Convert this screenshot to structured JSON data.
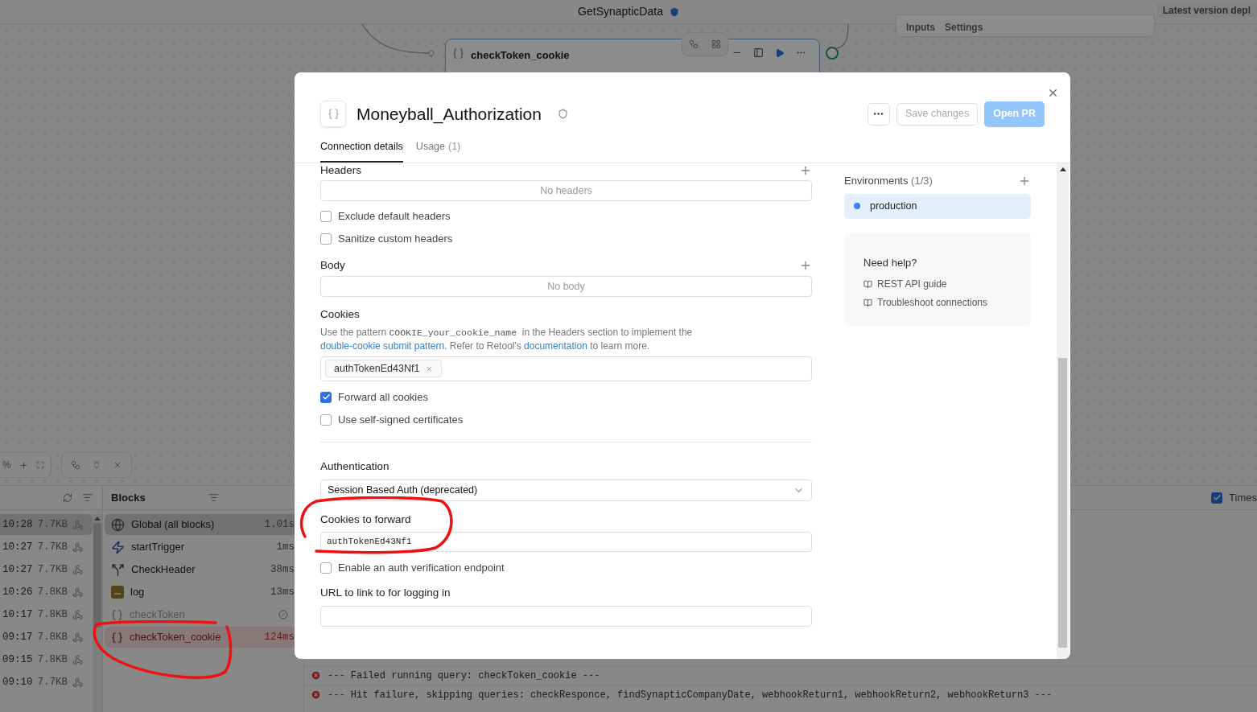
{
  "app": {
    "title": "GetSynapticData",
    "version_label": "Latest version depl"
  },
  "canvas": {
    "node": {
      "title": "checkToken_cookie"
    },
    "side_panel": {
      "tabs": [
        "Inputs",
        "Settings"
      ]
    },
    "zoom_label": "%"
  },
  "runs": {
    "rows": [
      {
        "time": "10:28",
        "size": "7.7KB",
        "selected": true
      },
      {
        "time": "10:27",
        "size": "7.7KB",
        "selected": false
      },
      {
        "time": "10:27",
        "size": "7.7KB",
        "selected": false
      },
      {
        "time": "10:26",
        "size": "7.8KB",
        "selected": false
      },
      {
        "time": "10:17",
        "size": "7.8KB",
        "selected": false
      },
      {
        "time": "09:17",
        "size": "7.8KB",
        "selected": false
      },
      {
        "time": "09:15",
        "size": "7.8KB",
        "selected": false
      },
      {
        "time": "09:10",
        "size": "7.7KB",
        "selected": false
      }
    ]
  },
  "blocks": {
    "title": "Blocks",
    "items": [
      {
        "kind": "global",
        "name": "Global (all blocks)",
        "duration": "1.01s",
        "skipped": false,
        "failed": false,
        "selected": true
      },
      {
        "kind": "trigger",
        "name": "startTrigger",
        "duration": "1ms",
        "skipped": false,
        "failed": false,
        "selected": false
      },
      {
        "kind": "branch",
        "name": "CheckHeader",
        "duration": "38ms",
        "skipped": false,
        "failed": false,
        "selected": false
      },
      {
        "kind": "js",
        "name": "log",
        "duration": "13ms",
        "skipped": false,
        "failed": false,
        "selected": false
      },
      {
        "kind": "resource",
        "name": "checkToken",
        "skipped": true,
        "failed": false,
        "selected": false
      },
      {
        "kind": "resource",
        "name": "checkToken_cookie",
        "duration": "124ms",
        "skipped": false,
        "failed": true,
        "selected": false
      }
    ]
  },
  "log": {
    "timestamps": {
      "label": "Times",
      "checked": true
    },
    "lines": [
      "--- Failed running query: checkToken_cookie ---",
      "--- Hit failure, skipping queries: checkResponce, findSynapticCompanyDate, webhookReturn1, webhookReturn2, webhookReturn3 ---"
    ]
  },
  "modal": {
    "title": "Moneyball_Authorization",
    "buttons": {
      "save": {
        "label": "Save changes",
        "disabled": true
      },
      "open_pr": {
        "label": "Open PR",
        "disabled": true
      }
    },
    "tabs": [
      {
        "label": "Connection details",
        "selected": true
      },
      {
        "label": "Usage",
        "count": "(1)",
        "selected": false
      }
    ],
    "headers": {
      "label": "Headers",
      "empty_text": "No headers"
    },
    "header_options": [
      {
        "label": "Exclude default headers",
        "checked": false
      },
      {
        "label": "Sanitize custom headers",
        "checked": false
      }
    ],
    "body": {
      "label": "Body",
      "empty_text": "No body"
    },
    "cookies": {
      "label": "Cookies",
      "description": [
        {
          "kind": "text",
          "text": "Use the pattern "
        },
        {
          "kind": "code",
          "text": "COOKIE_your_cookie_name"
        },
        {
          "kind": "text",
          "text": "  in the Headers section to implement the "
        },
        {
          "kind": "link",
          "text": "double-cookie submit pattern"
        },
        {
          "kind": "text",
          "text": ". Refer to Retool's "
        },
        {
          "kind": "link",
          "text": "documentation"
        },
        {
          "kind": "text",
          "text": " to learn more."
        }
      ],
      "tags": [
        "authTokenEd43Nf1"
      ],
      "options": [
        {
          "label": "Forward all cookies",
          "checked": true
        },
        {
          "label": "Use self-signed certificates",
          "checked": false
        }
      ]
    },
    "authentication": {
      "label": "Authentication",
      "value": "Session Based Auth (deprecated)"
    },
    "cookies_to_forward": {
      "label": "Cookies to forward",
      "value": "authTokenEd43Nf1"
    },
    "auth_endpoint": {
      "label": "Enable an auth verification endpoint",
      "checked": false
    },
    "login_url": {
      "label": "URL to link to for logging in"
    },
    "environments": {
      "label": "Environments",
      "count": "(1/3)",
      "items": [
        {
          "name": "production",
          "selected": true,
          "color": "#3b82f6"
        }
      ]
    },
    "help": {
      "title": "Need help?",
      "links": [
        "REST API guide",
        "Troubleshoot connections"
      ]
    }
  }
}
